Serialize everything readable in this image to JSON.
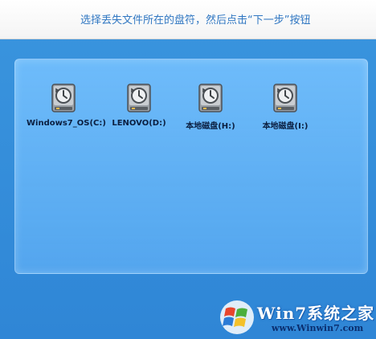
{
  "header": {
    "instruction": "选择丢失文件所在的盘符，然后点击“下一步”按钮"
  },
  "drives": [
    {
      "label": "Windows7_OS(C:)",
      "icon": "hard-drive-restore-icon"
    },
    {
      "label": "LENOVO(D:)",
      "icon": "hard-drive-restore-icon"
    },
    {
      "label": "本地磁盘(H:)",
      "icon": "hard-drive-restore-icon"
    },
    {
      "label": "本地磁盘(I:)",
      "icon": "hard-drive-restore-icon"
    }
  ],
  "watermark": {
    "brand": "Win7系统之家",
    "url": "www.Winwin7.com"
  },
  "colors": {
    "background": "#3a95de",
    "panel": "#78c3ff",
    "instruction_text": "#3077c2",
    "drive_label": "#0b1f40"
  }
}
